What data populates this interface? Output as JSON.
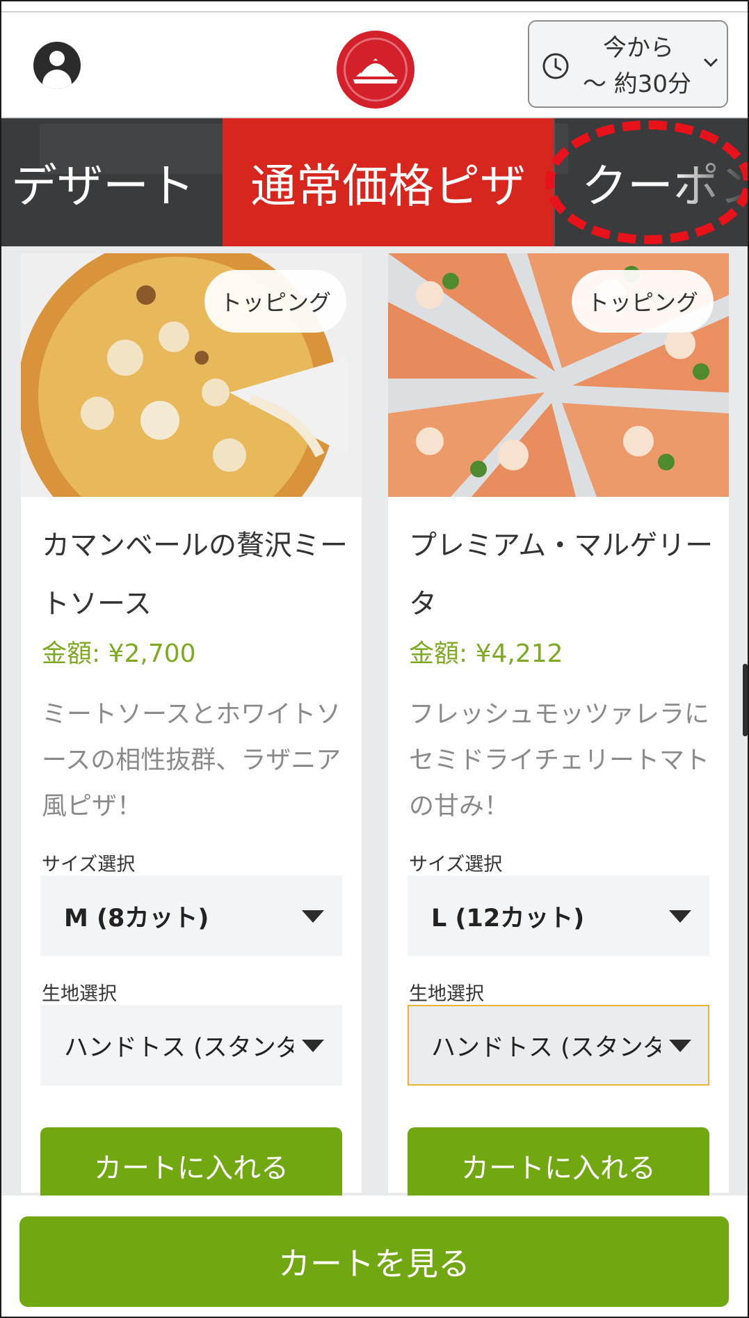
{
  "header": {
    "account_icon": "account-circle-icon",
    "logo_icon": "pizza-hut-logo",
    "time_selector": {
      "line1": "今から",
      "line2": "～ 約30分",
      "icon": "clock-icon"
    }
  },
  "category_nav": {
    "ghost_text": "カートに入れる",
    "tabs": [
      {
        "label": "デザート",
        "active": false
      },
      {
        "label": "通常価格ピザ",
        "active": true
      },
      {
        "label": "クーポン",
        "active": false
      }
    ],
    "highlight_color": "#e8121b"
  },
  "products": [
    {
      "badge": "トッピング",
      "title": "カマンベールの贅沢ミートソース",
      "price": "金額: ¥2,700",
      "description": "ミートソースとホワイトソースの相性抜群、ラザニア風ピザ！",
      "size_label": "サイズ選択",
      "size_value": "M (8カット)",
      "crust_label": "生地選択",
      "crust_value": "ハンドトス (スタンダード)",
      "add_to_cart": "カートに入れる"
    },
    {
      "badge": "トッピング",
      "title": "プレミアム・マルゲリータ",
      "price": "金額: ¥4,212",
      "description": "フレッシュモッツァレラにセミドライチェリートマトの甘み！",
      "size_label": "サイズ選択",
      "size_value": "L (12カット)",
      "crust_label": "生地選択",
      "crust_value": "ハンドトス (スタンダード)",
      "add_to_cart": "カートに入れる"
    }
  ],
  "bottom": {
    "view_cart": "カートを見る"
  },
  "colors": {
    "brand_red": "#d7261d",
    "accent_green": "#71a812",
    "price_green": "#7ea922",
    "nav_dark": "#3a3b3c"
  }
}
